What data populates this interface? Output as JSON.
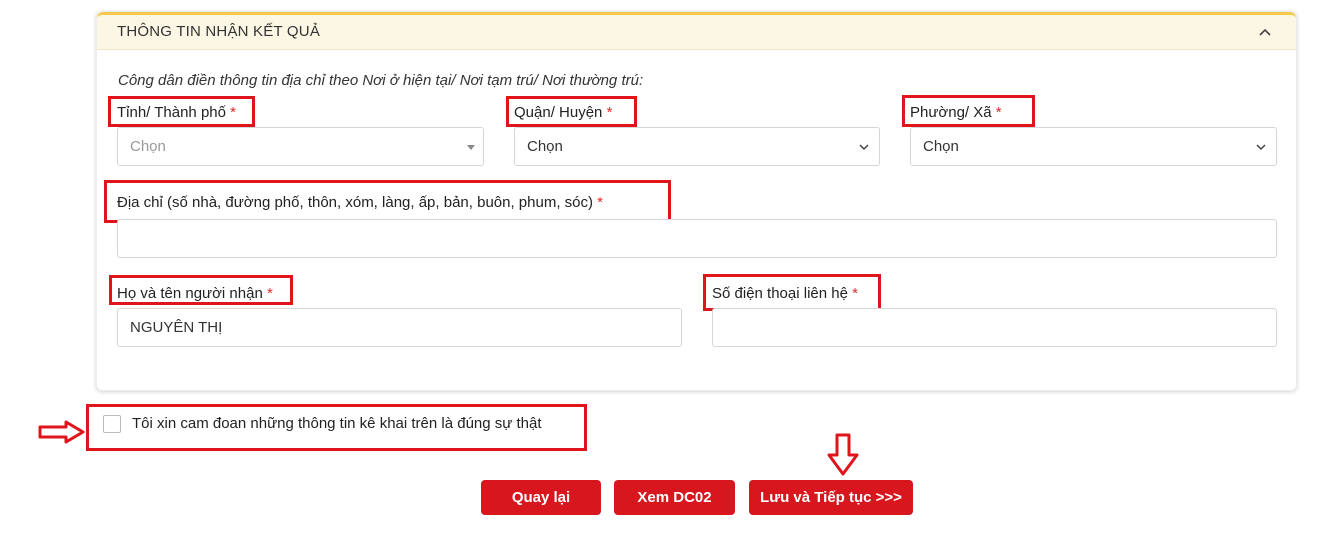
{
  "section": {
    "title": "THÔNG TIN NHẬN KẾT QUẢ",
    "note": "Công dân điền thông tin địa chỉ theo Nơi ở hiện tại/ Nơi tạm trú/ Nơi thường trú:"
  },
  "fields": {
    "province": {
      "label": "Tỉnh/ Thành phố",
      "value": "Chọn"
    },
    "district": {
      "label": "Quận/ Huyện",
      "value": "Chọn"
    },
    "ward": {
      "label": "Phường/ Xã",
      "value": "Chọn"
    },
    "address": {
      "label": "Địa chỉ (số nhà, đường phố, thôn, xóm, làng, ấp, bản, buôn, phum, sóc)",
      "value": ""
    },
    "recipient": {
      "label": "Họ và tên người nhận",
      "value": "NGUYÊN THỊ"
    },
    "phone": {
      "label": "Số điện thoại liên hệ",
      "value": ""
    }
  },
  "required_mark": "*",
  "agreement": {
    "label": "Tôi xin cam đoan những thông tin kê khai trên là đúng sự thật",
    "checked": false
  },
  "buttons": {
    "back": "Quay lại",
    "view": "Xem DC02",
    "save": "Lưu và Tiếp tục >>>"
  },
  "colors": {
    "accent": "#d7161e",
    "highlight": "#e0141b",
    "header_bg": "#fcf7e5",
    "header_border": "#f4c84a"
  }
}
